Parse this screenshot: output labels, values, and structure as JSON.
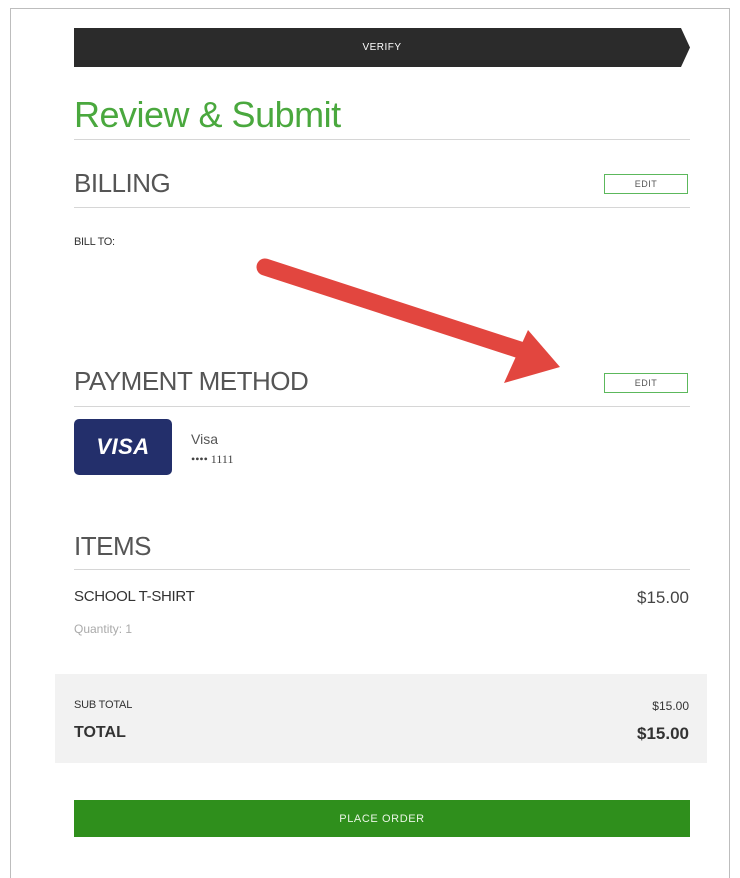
{
  "steps": {
    "current_label": "VERIFY"
  },
  "page": {
    "title": "Review & Submit"
  },
  "billing": {
    "heading": "BILLING",
    "edit_label": "EDIT",
    "bill_to_label": "BILL TO:"
  },
  "payment": {
    "heading": "PAYMENT METHOD",
    "edit_label": "EDIT",
    "card_brand_logo": "VISA",
    "card_name": "Visa",
    "card_number_masked": "•••• 1111"
  },
  "items": {
    "heading": "ITEMS",
    "list": [
      {
        "name": "SCHOOL T-SHIRT",
        "quantity_text": "Quantity: 1",
        "price": "$15.00"
      }
    ]
  },
  "totals": {
    "subtotal_label": "SUB TOTAL",
    "subtotal_value": "$15.00",
    "total_label": "TOTAL",
    "total_value": "$15.00"
  },
  "actions": {
    "place_order_label": "PLACE ORDER"
  },
  "colors": {
    "brand_green": "#4aa83e",
    "place_order_green": "#2f8f1c",
    "step_bar": "#2b2b2b",
    "visa_blue": "#232f6b",
    "annotation_arrow": "#e2463f"
  },
  "icons": {
    "annotation": "red-arrow-icon",
    "card": "visa-logo-icon"
  }
}
